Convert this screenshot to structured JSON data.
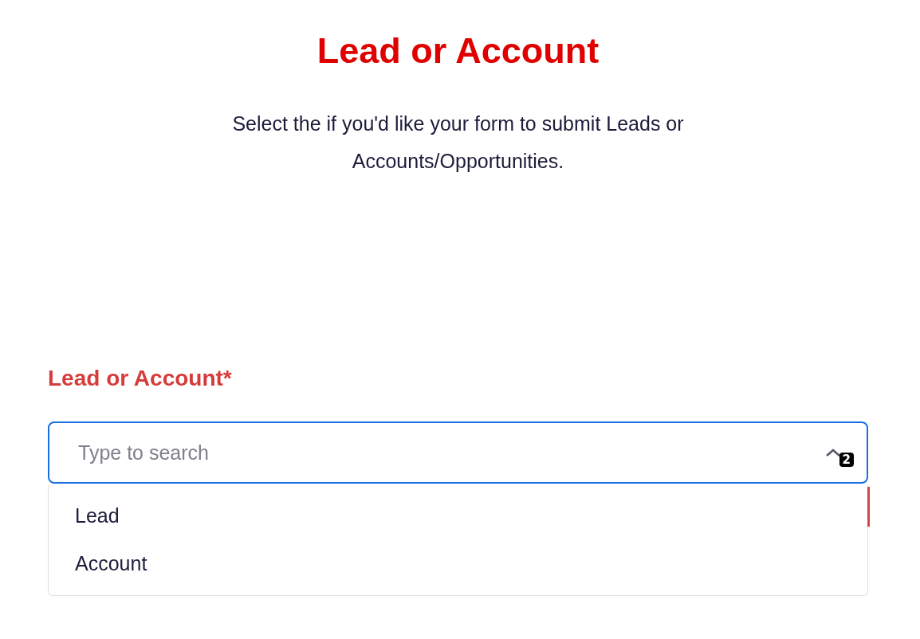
{
  "heading": "Lead or Account",
  "description": "Select the if you'd like your form to submit Leads or Accounts/Opportunities.",
  "field": {
    "label": "Lead or Account*",
    "placeholder": "Type to search",
    "focused": true,
    "expanded": true,
    "error": true,
    "badge": "2",
    "options": [
      {
        "label": "Lead",
        "selected": false
      },
      {
        "label": "Account",
        "selected": false
      }
    ]
  }
}
